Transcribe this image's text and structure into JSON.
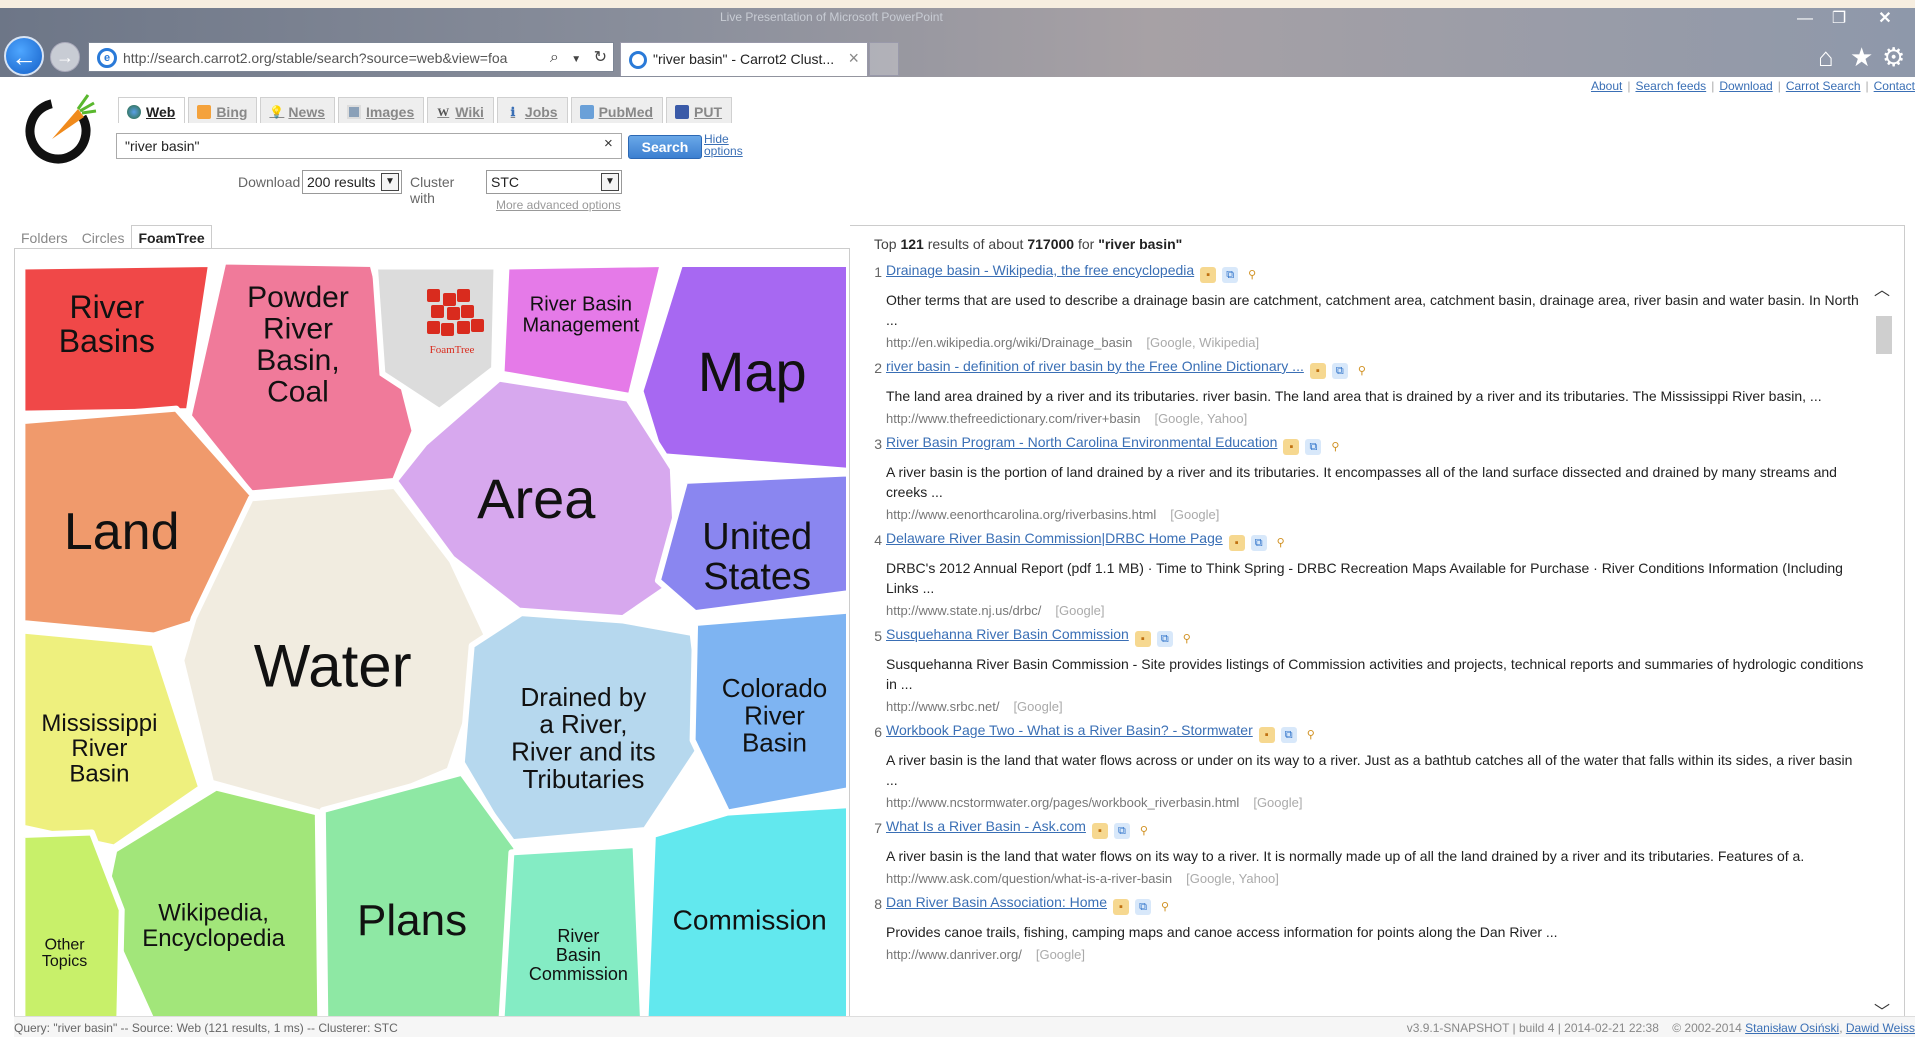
{
  "browser": {
    "window_title": "Live Presentation of Microsoft PowerPoint",
    "url": "http://search.carrot2.org/stable/search?source=web&view=foa",
    "tab_title": "\"river basin\" - Carrot2 Clust...",
    "minimize": "—",
    "restore": "❐",
    "close": "✕"
  },
  "top_links": [
    "About",
    "Search feeds",
    "Download",
    "Carrot Search",
    "Contact"
  ],
  "source_tabs": [
    {
      "label": "Web",
      "icon": "globe-icon",
      "active": true
    },
    {
      "label": "Bing",
      "icon": "bing-icon",
      "active": false
    },
    {
      "label": "News",
      "icon": "bulb-icon",
      "active": false
    },
    {
      "label": "Images",
      "icon": "image-icon",
      "active": false
    },
    {
      "label": "Wiki",
      "icon": "wiki-icon",
      "active": false
    },
    {
      "label": "Jobs",
      "icon": "info-icon",
      "active": false
    },
    {
      "label": "PubMed",
      "icon": "pubmed-icon",
      "active": false
    },
    {
      "label": "PUT",
      "icon": "put-icon",
      "active": false
    }
  ],
  "search": {
    "query": "\"river basin\"",
    "clear": "×",
    "button": "Search",
    "hide_options": "Hide options",
    "download_label": "Download",
    "download_value": "200 results",
    "cluster_label": "Cluster with",
    "cluster_value": "STC",
    "more_advanced": "More advanced options"
  },
  "view_tabs": [
    {
      "label": "Folders",
      "active": false
    },
    {
      "label": "Circles",
      "active": false
    },
    {
      "label": "FoamTree",
      "active": true
    }
  ],
  "foamtree": {
    "logo_text": "FoamTree",
    "clusters": [
      {
        "label": "River Basins",
        "color": "#f04848"
      },
      {
        "label": "Powder River Basin, Coal",
        "color": "#f07a9a"
      },
      {
        "label": "River Basin Management",
        "color": "#e57ae8"
      },
      {
        "label": "Map",
        "color": "#a768f2"
      },
      {
        "label": "Land",
        "color": "#f09a6c"
      },
      {
        "label": "Area",
        "color": "#d7a8ee"
      },
      {
        "label": "United States",
        "color": "#8a86f0"
      },
      {
        "label": "Water",
        "color": "#f1ece0"
      },
      {
        "label": "Drained by a River, River and its Tributaries",
        "color": "#b6d8ee"
      },
      {
        "label": "Colorado River Basin",
        "color": "#7eb4f2"
      },
      {
        "label": "Mississippi River Basin",
        "color": "#eef07e"
      },
      {
        "label": "Wikipedia, Encyclopedia",
        "color": "#a2e67a"
      },
      {
        "label": "Plans",
        "color": "#8ee8a4"
      },
      {
        "label": "River Basin Commission",
        "color": "#84ecc4"
      },
      {
        "label": "Commission",
        "color": "#62e8ee"
      },
      {
        "label": "Other Topics",
        "color": "#c8f06a"
      }
    ]
  },
  "results_header": {
    "prefix": "Top",
    "count": "121",
    "middle": "results of about",
    "total": "717000",
    "for": "for",
    "query": "\"river basin\""
  },
  "results": [
    {
      "num": "1",
      "title": "Drainage basin - Wikipedia, the free encyclopedia",
      "snippet": "Other terms that are used to describe a drainage basin are catchment, catchment area, catchment basin, drainage area, river basin and water basin. In North ...",
      "url": "http://en.wikipedia.org/wiki/Drainage_basin",
      "sources": "[Google, Wikipedia]"
    },
    {
      "num": "2",
      "title": "river basin - definition of river basin by the Free Online Dictionary ...",
      "snippet": "The land area drained by a river and its tributaries. river basin. The land area that is drained by a river and its tributaries. The Mississippi River basin, ...",
      "url": "http://www.thefreedictionary.com/river+basin",
      "sources": "[Google, Yahoo]"
    },
    {
      "num": "3",
      "title": "River Basin Program - North Carolina Environmental Education",
      "snippet": "A river basin is the portion of land drained by a river and its tributaries. It encompasses all of the land surface dissected and drained by many streams and creeks ...",
      "url": "http://www.eenorthcarolina.org/riverbasins.html",
      "sources": "[Google]"
    },
    {
      "num": "4",
      "title": "Delaware River Basin Commission|DRBC Home Page",
      "snippet": "DRBC's 2012 Annual Report (pdf 1.1 MB) · Time to Think Spring - DRBC Recreation Maps Available for Purchase · River Conditions Information (Including Links ...",
      "url": "http://www.state.nj.us/drbc/",
      "sources": "[Google]"
    },
    {
      "num": "5",
      "title": "Susquehanna River Basin Commission",
      "snippet": "Susquehanna River Basin Commission - Site provides listings of Commission activities and projects, technical reports and summaries of hydrologic conditions in ...",
      "url": "http://www.srbc.net/",
      "sources": "[Google]"
    },
    {
      "num": "6",
      "title": "Workbook Page Two - What is a River Basin? - Stormwater",
      "snippet": "A river basin is the land that water flows across or under on its way to a river. Just as a bathtub catches all of the water that falls within its sides, a river basin ...",
      "url": "http://www.ncstormwater.org/pages/workbook_riverbasin.html",
      "sources": "[Google]"
    },
    {
      "num": "7",
      "title": "What Is a River Basin - Ask.com",
      "snippet": "A river basin is the land that water flows on its way to a river. It is normally made up of all the land drained by a river and its tributaries. Features of a.",
      "url": "http://www.ask.com/question/what-is-a-river-basin",
      "sources": "[Google, Yahoo]"
    },
    {
      "num": "8",
      "title": "Dan River Basin Association: Home",
      "snippet": "Provides canoe trails, fishing, camping maps and canoe access information for points along the Dan River ...",
      "url": "http://www.danriver.org/",
      "sources": "[Google]"
    }
  ],
  "status": {
    "left": "Query: \"river basin\" -- Source: Web (121 results, 1 ms) -- Clusterer: STC",
    "version": "v3.9.1-SNAPSHOT | build 4 | 2014-02-21 22:38",
    "copyright": "© 2002-2014",
    "author1": "Stanisław Osiński",
    "author2": "Dawid Weiss"
  }
}
